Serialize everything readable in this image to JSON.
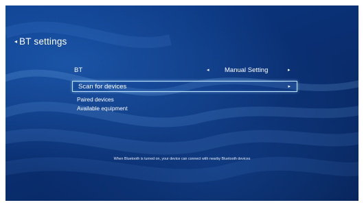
{
  "header": {
    "back_icon": "◂",
    "title": "BT settings"
  },
  "bt_row": {
    "label": "BT",
    "left_arrow": "◂",
    "value": "Manual Setting",
    "right_arrow": "▸"
  },
  "scan_row": {
    "label": "Scan for devices",
    "right_arrow": "▸"
  },
  "sections": {
    "paired": "Paired devices",
    "available": "Available equipment"
  },
  "footer": {
    "note": "When Bluetooth is turned on, your device can connect with nearby Bluetooth devices"
  },
  "colors": {
    "background": "#0a2f72",
    "focus_border": "#bfe3ff",
    "text": "#ffffff"
  }
}
